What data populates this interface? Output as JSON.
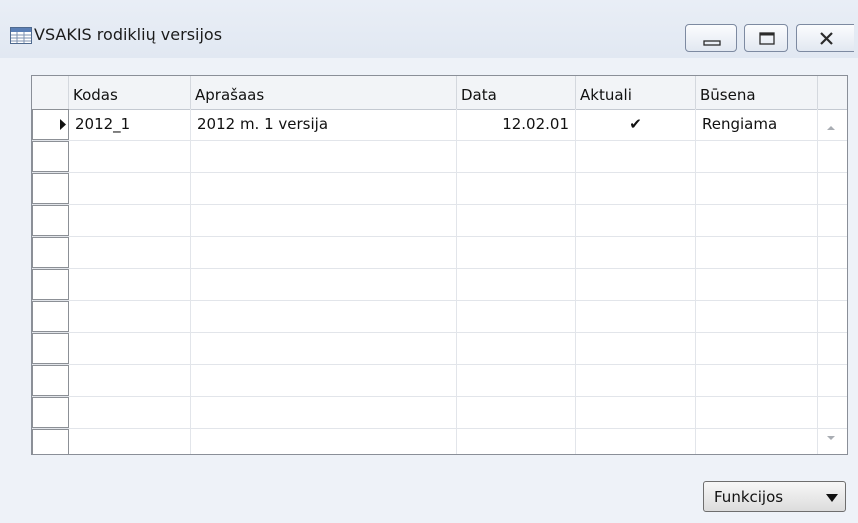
{
  "window": {
    "title": "VSAKIS rodiklių versijos",
    "icon": "table-grid-icon",
    "controls": [
      "minimize-icon",
      "maximize-icon",
      "close-icon"
    ]
  },
  "table": {
    "columns": [
      "Kodas",
      "Aprašaas",
      "Data",
      "Aktuali",
      "Būsena"
    ],
    "rows": [
      {
        "kodas": "2012_1",
        "aprasas": "2012 m. 1 versija",
        "data": "12.02.01",
        "aktuali": "✔",
        "busena": "Rengiama"
      }
    ],
    "empty_rows": 10
  },
  "buttons": {
    "funkcijos": "Funkcijos"
  },
  "colors": {
    "background": "#eef2f8",
    "grid_border": "#8a8f98"
  }
}
